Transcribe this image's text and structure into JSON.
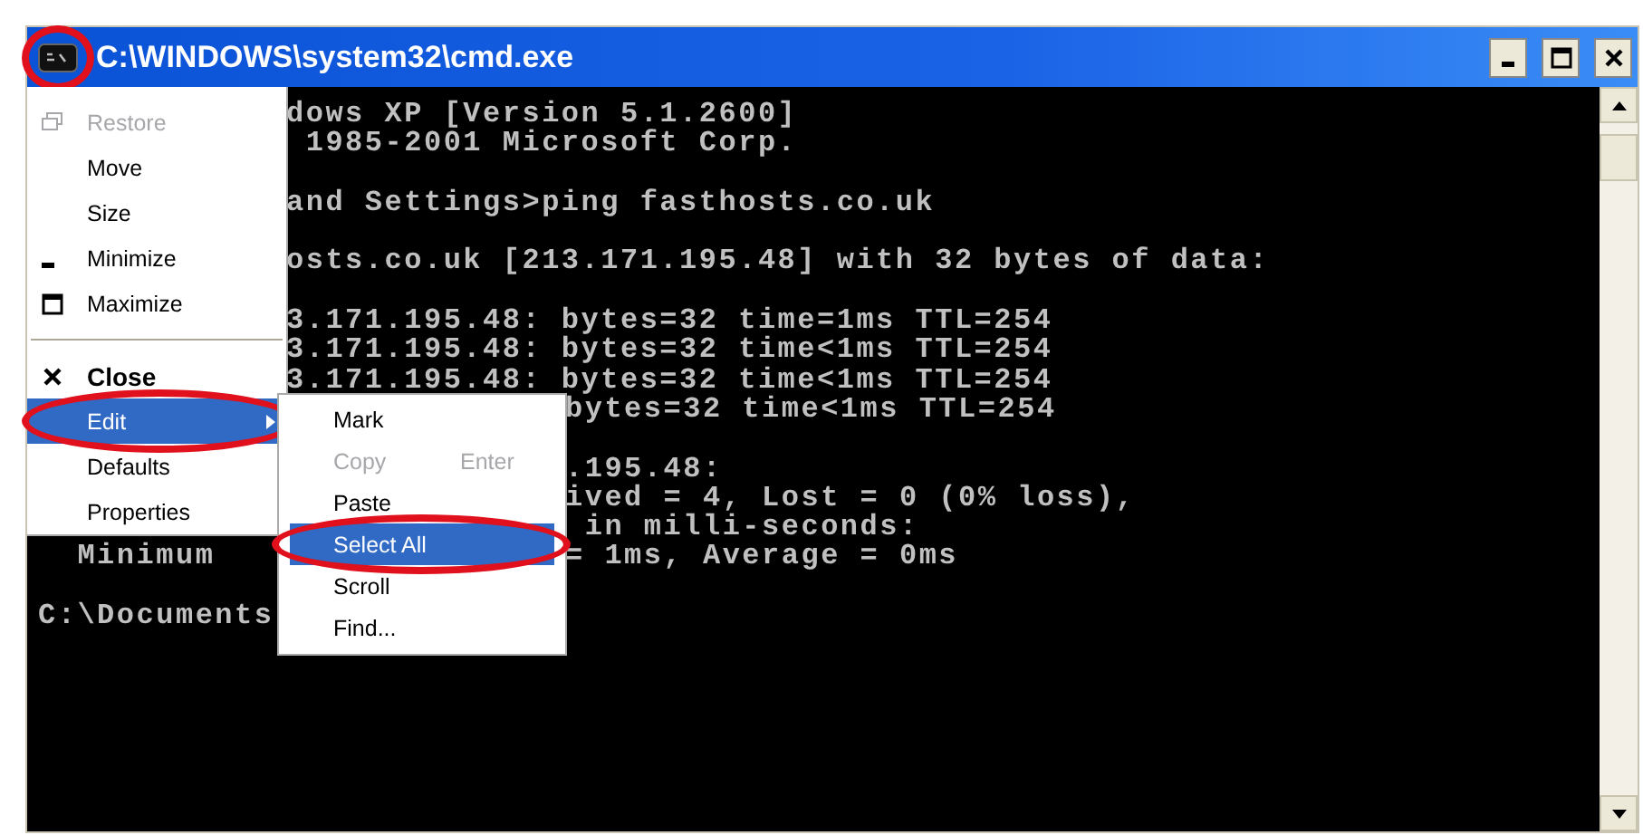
{
  "window": {
    "title": "C:\\WINDOWS\\system32\\cmd.exe",
    "icon_circled": true
  },
  "console_lines": [
    {
      "kind": "text",
      "middle": "dows XP [Version 5.1.2600]"
    },
    {
      "kind": "text",
      "middle": " 1985-2001 Microsoft Corp."
    },
    {
      "kind": "blank"
    },
    {
      "kind": "text",
      "middle": "and Settings>ping fasthosts.co.uk"
    },
    {
      "kind": "blank"
    },
    {
      "kind": "text",
      "middle": "osts.co.uk [213.171.195.48] with 32 bytes of data:"
    },
    {
      "kind": "blank"
    },
    {
      "kind": "text",
      "middle": "3.171.195.48: bytes=32 time=1ms TTL=254"
    },
    {
      "kind": "text",
      "middle": "3.171.195.48: bytes=32 time<1ms TTL=254"
    },
    {
      "kind": "text",
      "middle": "3.171.195.48: bytes=32 time<1ms TTL=254"
    },
    {
      "kind": "text",
      "right": "bytes=32 time<1ms TTL=254"
    },
    {
      "kind": "blank"
    },
    {
      "kind": "text",
      "right": ".195.48:"
    },
    {
      "kind": "text",
      "right": "ived = 4, Lost = 0 (0% loss),"
    },
    {
      "kind": "text",
      "right": " in milli-seconds:"
    },
    {
      "kind": "text",
      "left": "  Minimum",
      "right": "= 1ms, Average = 0ms"
    },
    {
      "kind": "blank"
    },
    {
      "kind": "text",
      "left": "C:\\Documents"
    }
  ],
  "system_menu": [
    {
      "kind": "restore",
      "label": "Restore",
      "disabled": true,
      "bold": false,
      "selected": false,
      "circled": false,
      "submenu": false
    },
    {
      "kind": "plain",
      "label": "Move",
      "disabled": false,
      "bold": false,
      "selected": false,
      "circled": false,
      "submenu": false
    },
    {
      "kind": "plain",
      "label": "Size",
      "disabled": false,
      "bold": false,
      "selected": false,
      "circled": false,
      "submenu": false
    },
    {
      "kind": "minimize",
      "label": "Minimize",
      "disabled": false,
      "bold": false,
      "selected": false,
      "circled": false,
      "submenu": false
    },
    {
      "kind": "maximize",
      "label": "Maximize",
      "disabled": false,
      "bold": false,
      "selected": false,
      "circled": false,
      "submenu": false
    },
    {
      "kind": "separator"
    },
    {
      "kind": "close",
      "label": "Close",
      "disabled": false,
      "bold": true,
      "selected": false,
      "circled": false,
      "submenu": false
    },
    {
      "kind": "plain",
      "label": "Edit",
      "disabled": false,
      "bold": false,
      "selected": true,
      "circled": true,
      "submenu": true
    },
    {
      "kind": "plain",
      "label": "Defaults",
      "disabled": false,
      "bold": false,
      "selected": false,
      "circled": false,
      "submenu": false
    },
    {
      "kind": "plain",
      "label": "Properties",
      "disabled": false,
      "bold": false,
      "selected": false,
      "circled": false,
      "submenu": false
    }
  ],
  "edit_submenu": [
    {
      "label": "Mark",
      "disabled": false,
      "selected": false,
      "circled": false
    },
    {
      "label": "Copy",
      "shortcut": "Enter",
      "disabled": true,
      "selected": false,
      "circled": false
    },
    {
      "label": "Paste",
      "disabled": false,
      "selected": false,
      "circled": false
    },
    {
      "label": "Select All",
      "disabled": false,
      "selected": true,
      "circled": true
    },
    {
      "label": "Scroll",
      "disabled": false,
      "selected": false,
      "circled": false
    },
    {
      "label": "Find...",
      "disabled": false,
      "selected": false,
      "circled": false
    }
  ]
}
